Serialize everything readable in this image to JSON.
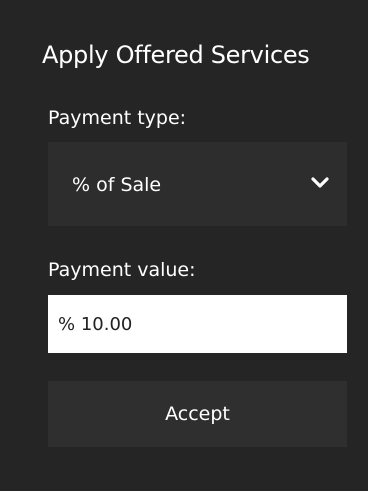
{
  "dialog": {
    "title": "Apply Offered Services",
    "payment_type": {
      "label": "Payment type:",
      "selected": "% of Sale",
      "icon": "chevron-down-icon"
    },
    "payment_value": {
      "label": "Payment value:",
      "value": "% 10.00"
    },
    "accept_label": "Accept"
  },
  "colors": {
    "panel_bg": "#252525",
    "control_bg": "#2d2d2d",
    "text": "#ffffff",
    "input_bg": "#ffffff"
  }
}
